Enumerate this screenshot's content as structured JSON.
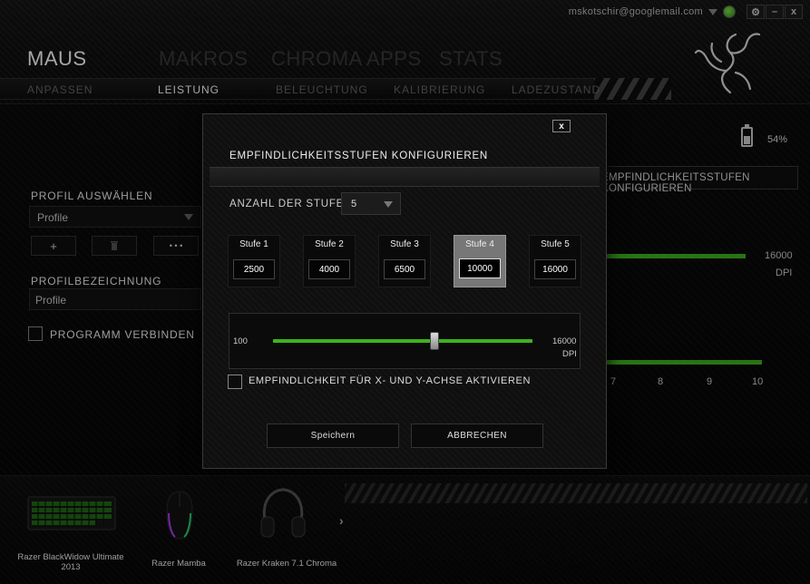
{
  "account": {
    "email": "mskotschir@googlemail.com"
  },
  "window_controls": {
    "settings": "⚙",
    "minimize": "–",
    "close": "x"
  },
  "main_tabs": [
    "MAUS",
    "MAKROS",
    "CHROMA APPS",
    "STATS"
  ],
  "sub_tabs": [
    "ANPASSEN",
    "LEISTUNG",
    "BELEUCHTUNG",
    "KALIBRIERUNG",
    "LADEZUSTAND"
  ],
  "battery": {
    "percent": "54%",
    "level": 0.54
  },
  "left_panel": {
    "profile_label": "PROFIL AUSWÄHLEN",
    "profile_value": "Profile",
    "add_label": "+",
    "more_label": "• • •",
    "name_label": "PROFILBEZEICHNUNG",
    "name_value": "Profile",
    "program_link_label": "PROGRAMM VERBINDEN"
  },
  "background_panel": {
    "title": "EMPFINDLICHKEITSSTUFEN KONFIGURIEREN",
    "max_value": "16000",
    "unit": "DPI",
    "ticks": [
      "7",
      "8",
      "9",
      "10"
    ]
  },
  "devices": [
    {
      "name": "Razer BlackWidow Ultimate 2013"
    },
    {
      "name": "Razer Mamba"
    },
    {
      "name": "Razer Kraken 7.1 Chroma"
    }
  ],
  "modal": {
    "close_label": "x",
    "title": "EMPFINDLICHKEITSSTUFEN KONFIGURIEREN",
    "stages_label": "ANZAHL DER STUFEN",
    "stages_value": "5",
    "stages": [
      {
        "label": "Stufe 1",
        "value": "2500"
      },
      {
        "label": "Stufe 2",
        "value": "4000"
      },
      {
        "label": "Stufe 3",
        "value": "6500"
      },
      {
        "label": "Stufe 4",
        "value": "10000"
      },
      {
        "label": "Stufe 5",
        "value": "16000"
      }
    ],
    "selected_stage": 4,
    "slider": {
      "min": "100",
      "max": "16000",
      "unit": "DPI",
      "value": 10000
    },
    "axis_checkbox_label": "EMPFINDLICHKEIT FÜR X- UND Y-ACHSE AKTIVIEREN",
    "save_label": "Speichern",
    "cancel_label": "ABBRECHEN"
  },
  "colors": {
    "accent_green": "#3cb41c",
    "status_green": "#5ec22a"
  }
}
